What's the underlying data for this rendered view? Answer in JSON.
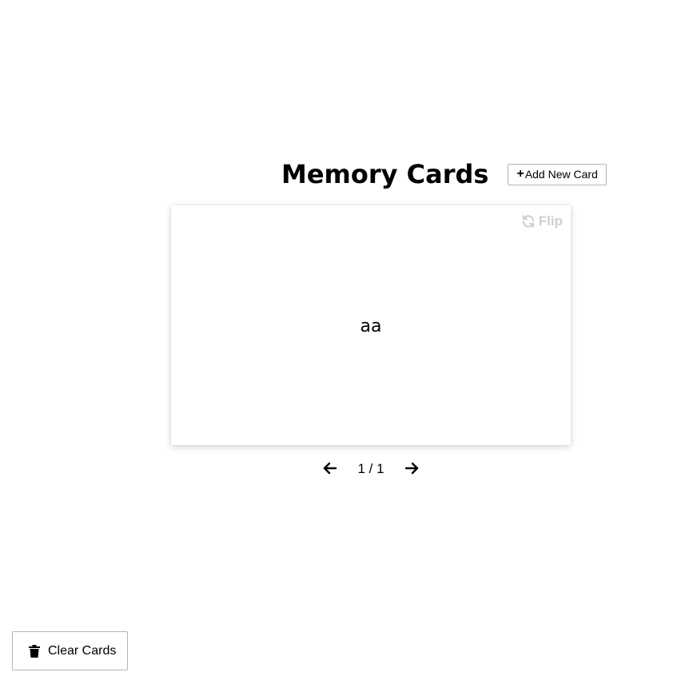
{
  "header": {
    "title": "Memory Cards",
    "add_button_icon": "plus-icon",
    "add_button_label": "Add New Card"
  },
  "card": {
    "text": "aa",
    "flip_label": "Flip",
    "flip_icon": "sync-icon"
  },
  "navigation": {
    "prev_icon": "arrow-left-icon",
    "next_icon": "arrow-right-icon",
    "counter": "1 / 1"
  },
  "footer": {
    "clear_button_label": "Clear Cards",
    "clear_button_icon": "trash-icon"
  },
  "colors": {
    "background": "#ffffff",
    "text": "#000000",
    "flip_muted": "#cfcfcf",
    "border": "#b5b5b5"
  }
}
